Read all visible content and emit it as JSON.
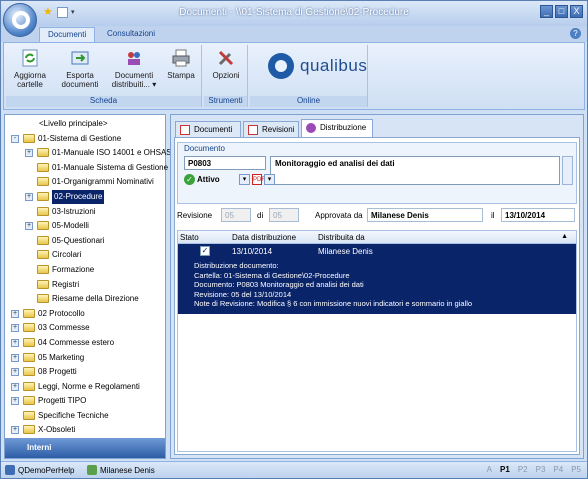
{
  "window": {
    "title": "Documenti - \\\\01-Sistema di Gestione\\02-Procedure",
    "controls": [
      "_",
      "□",
      "X"
    ]
  },
  "quick_access": {
    "icons": [
      "star-icon",
      "page-icon",
      "dropdown-icon"
    ]
  },
  "ribbon_tabs": [
    "Documenti",
    "Consultazioni"
  ],
  "ribbon": {
    "groups": [
      {
        "label": "Scheda",
        "buttons": [
          "Aggiorna\ncartelle",
          "Esporta\ndocumenti",
          "Documenti\ndistribuiti...",
          "Stampa"
        ]
      },
      {
        "label": "Strumenti",
        "buttons": [
          "Opzioni"
        ]
      },
      {
        "label": "Online",
        "logo": "qualibus"
      }
    ],
    "btn_aggiorna_1": "Aggiorna",
    "btn_aggiorna_2": "cartelle",
    "btn_esporta_1": "Esporta",
    "btn_esporta_2": "documenti",
    "btn_distrib_1": "Documenti",
    "btn_distrib_2": "distribuiti... ▾",
    "btn_stampa": "Stampa",
    "btn_opzioni": "Opzioni",
    "group_scheda": "Scheda",
    "group_strumenti": "Strumenti",
    "group_online": "Online",
    "logo_text": "qualibus"
  },
  "tree": {
    "items": [
      {
        "label": "<Livello principale>",
        "indent": 0,
        "exp": "",
        "folder": false
      },
      {
        "label": "01-Sistema di Gestione",
        "indent": 0,
        "exp": "-",
        "folder": true
      },
      {
        "label": "01-Manuale ISO 14001 e OHSAS",
        "indent": 1,
        "exp": "+",
        "folder": true
      },
      {
        "label": "01-Manuale Sistema di Gestione",
        "indent": 1,
        "exp": "",
        "folder": true
      },
      {
        "label": "01-Organigrammi Nominativi",
        "indent": 1,
        "exp": "",
        "folder": true
      },
      {
        "label": "02-Procedure",
        "indent": 1,
        "exp": "+",
        "folder": true,
        "selected": true
      },
      {
        "label": "03-Istruzioni",
        "indent": 1,
        "exp": "",
        "folder": true
      },
      {
        "label": "05-Modelli",
        "indent": 1,
        "exp": "+",
        "folder": true
      },
      {
        "label": "05-Questionari",
        "indent": 1,
        "exp": "",
        "folder": true
      },
      {
        "label": "Circolari",
        "indent": 1,
        "exp": "",
        "folder": true
      },
      {
        "label": "Formazione",
        "indent": 1,
        "exp": "",
        "folder": true
      },
      {
        "label": "Registri",
        "indent": 1,
        "exp": "",
        "folder": true
      },
      {
        "label": "Riesame della Direzione",
        "indent": 1,
        "exp": "",
        "folder": true
      },
      {
        "label": "02 Protocollo",
        "indent": 0,
        "exp": "+",
        "folder": true
      },
      {
        "label": "03 Commesse",
        "indent": 0,
        "exp": "+",
        "folder": true
      },
      {
        "label": "04 Commesse estero",
        "indent": 0,
        "exp": "+",
        "folder": true
      },
      {
        "label": "05 Marketing",
        "indent": 0,
        "exp": "+",
        "folder": true
      },
      {
        "label": "08 Progetti",
        "indent": 0,
        "exp": "+",
        "folder": true
      },
      {
        "label": "Leggi, Norme e Regolamenti",
        "indent": 0,
        "exp": "+",
        "folder": true
      },
      {
        "label": "Progetti TIPO",
        "indent": 0,
        "exp": "+",
        "folder": true
      },
      {
        "label": "Specifiche Tecniche",
        "indent": 0,
        "exp": "",
        "folder": true
      },
      {
        "label": "X-Obsoleti",
        "indent": 0,
        "exp": "+",
        "folder": true
      }
    ],
    "footer": "Interni"
  },
  "content_tabs": [
    "Documenti",
    "Revisioni",
    "Distribuzione"
  ],
  "documento": {
    "group_label": "Documento",
    "code": "P0803",
    "title": "Monitoraggio ed analisi dei dati",
    "status": "Attivo"
  },
  "revisione": {
    "label": "Revisione",
    "value": "05",
    "di_label": "di",
    "di_value": "05",
    "approvata_label": "Approvata da",
    "approvata_value": "Milanese Denis",
    "il_label": "il",
    "il_value": "13/10/2014"
  },
  "grid": {
    "columns": [
      "Stato",
      "Data distribuzione",
      "Distribuita da"
    ],
    "rows": [
      {
        "checked": true,
        "data": "13/10/2014",
        "da": "Milanese Denis"
      }
    ],
    "detail": {
      "l1": "Distribuzione documento:",
      "l2": "Cartella: 01-Sistema di Gestione\\02-Procedure",
      "l3": "Documento: P0803 Monitoraggio ed analisi dei dati",
      "l4": "Revisione: 05 del 13/10/2014",
      "l5": "Note di Revisione: Modifica § 6 con immissione nuovi indicatori e sommario in giallo"
    }
  },
  "statusbar": {
    "db": "QDemoPerHelp",
    "user": "Milanese Denis",
    "pager": [
      "A",
      "P1",
      "P2",
      "P3",
      "P4",
      "P5"
    ],
    "active_page": "P1"
  },
  "colors": {
    "selection": "#0a246a",
    "ribbon": "#e9f1fc",
    "accent": "#15428b"
  }
}
